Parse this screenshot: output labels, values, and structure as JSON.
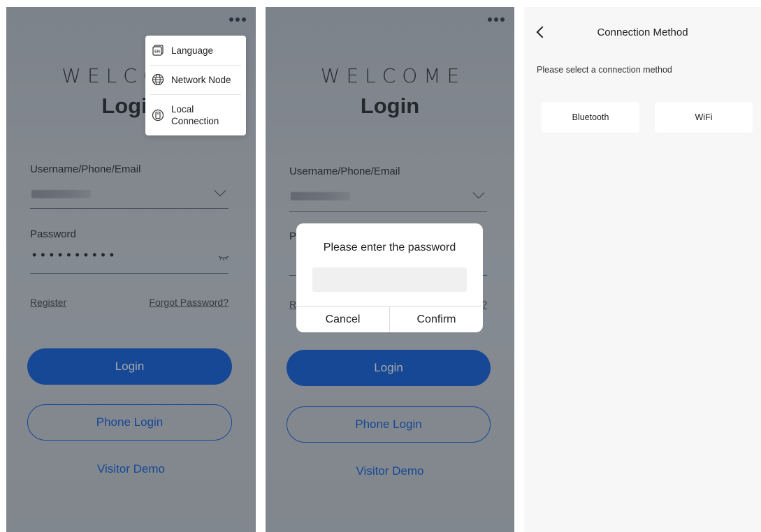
{
  "screen1": {
    "welcome": "WELCOME",
    "title": "Login",
    "username_label": "Username/Phone/Email",
    "password_label": "Password",
    "password_mask": "••••••••••",
    "register": "Register",
    "forgot": "Forgot Password?",
    "login_button": "Login",
    "phone_login_button": "Phone Login",
    "visitor_demo": "Visitor Demo",
    "menu": {
      "items": [
        {
          "label": "Language",
          "icon": "language-en-icon"
        },
        {
          "label": "Network Node",
          "icon": "globe-icon"
        },
        {
          "label": "Local\nConnection",
          "icon": "device-icon"
        }
      ]
    }
  },
  "screen2": {
    "welcome": "WELCOME",
    "title": "Login",
    "username_label": "Username/Phone/Email",
    "password_label_partial": "P",
    "register_partial": "R",
    "forgot_partial": "?",
    "login_button": "Login",
    "phone_login_button": "Phone Login",
    "visitor_demo": "Visitor Demo",
    "dialog": {
      "title": "Please enter the password",
      "input_value": "",
      "cancel": "Cancel",
      "confirm": "Confirm"
    }
  },
  "screen3": {
    "title": "Connection Method",
    "subtitle": "Please select a connection method",
    "options": [
      "Bluetooth",
      "WiFi"
    ]
  },
  "colors": {
    "primary": "#0b5ad8",
    "overlay": "rgba(40,48,58,0.42)"
  }
}
